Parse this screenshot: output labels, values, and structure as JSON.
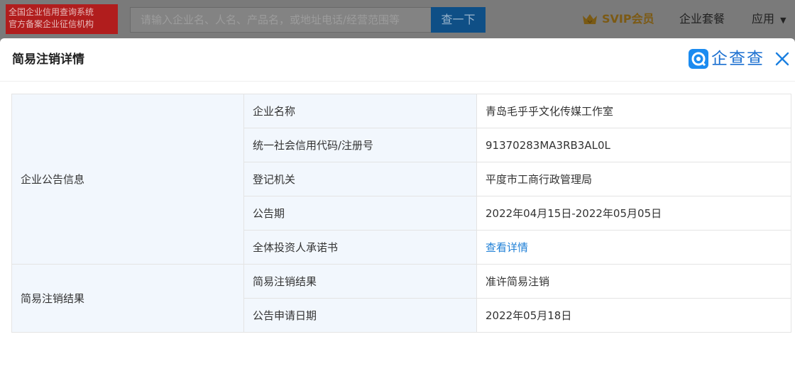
{
  "topbar": {
    "brand_line1": "全国企业信用查询系统",
    "brand_line2": "官方备案企业征信机构",
    "search_placeholder": "请输入企业名、人名、产品名，或地址电话/经营范围等",
    "search_button": "查一下",
    "svip": "SVIP会员",
    "package": "企业套餐",
    "apps": "应用"
  },
  "modal": {
    "title": "简易注销详情",
    "logo_text": "企查查"
  },
  "groups": [
    {
      "name": "企业公告信息",
      "rows": [
        {
          "field": "企业名称",
          "value": "青岛毛乎乎文化传媒工作室"
        },
        {
          "field": "统一社会信用代码/注册号",
          "value": "91370283MA3RB3AL0L"
        },
        {
          "field": "登记机关",
          "value": "平度市工商行政管理局"
        },
        {
          "field": "公告期",
          "value": "2022年04月15日-2022年05月05日"
        },
        {
          "field": "全体投资人承诺书",
          "value": "查看详情"
        }
      ]
    },
    {
      "name": "简易注销结果",
      "rows": [
        {
          "field": "简易注销结果",
          "value": "准许简易注销"
        },
        {
          "field": "公告申请日期",
          "value": "2022年05月18日"
        }
      ]
    }
  ],
  "colors": {
    "accent": "#1e7fd6",
    "label_bg": "#f2f7fd",
    "border": "#e4e4e4"
  }
}
